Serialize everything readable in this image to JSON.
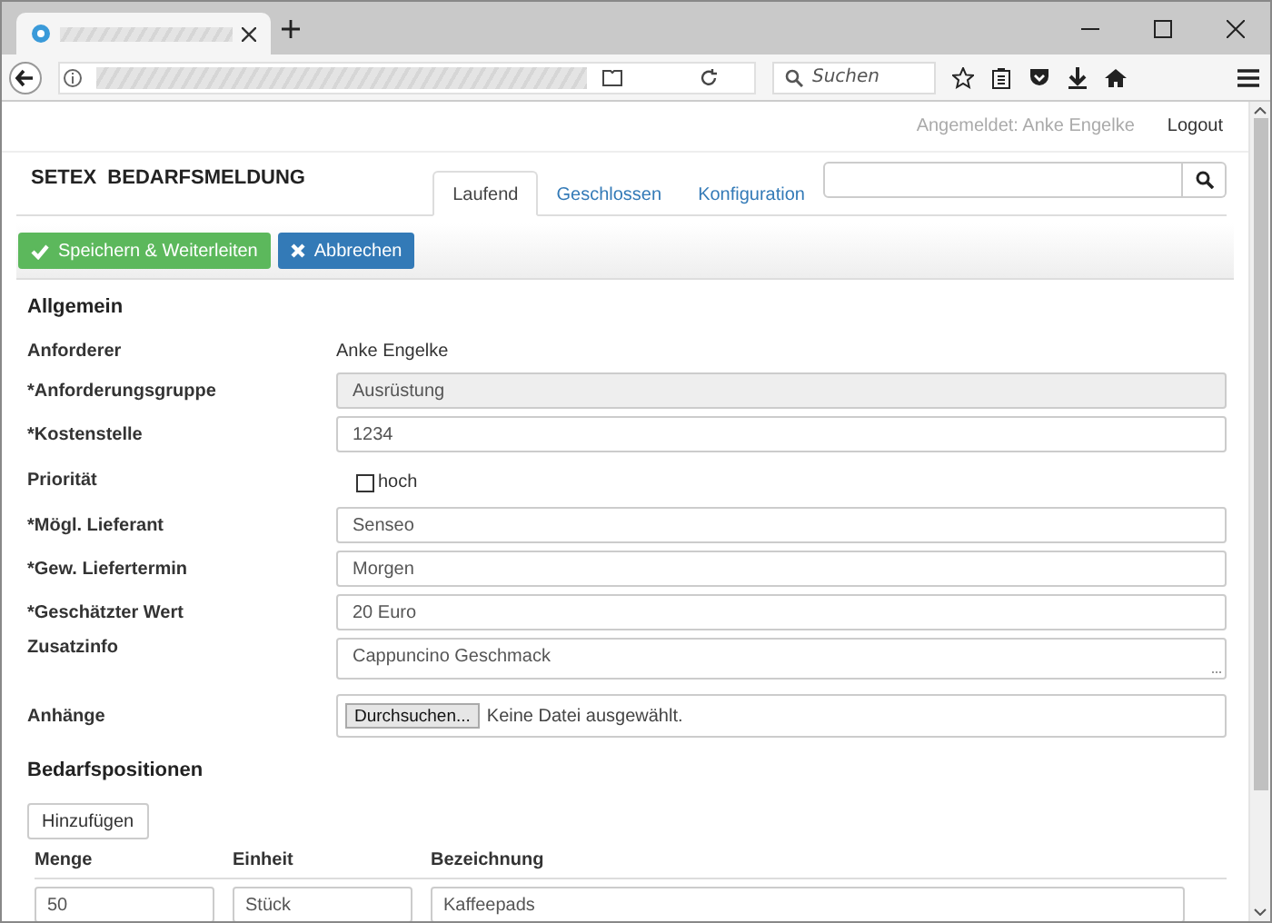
{
  "browser": {
    "search_placeholder": "Suchen"
  },
  "header": {
    "user": "Angemeldet: Anke Engelke",
    "logout": "Logout",
    "title": "SETEX  BEDARFSMELDUNG"
  },
  "tabs": [
    {
      "label": "Laufend",
      "selected": true
    },
    {
      "label": "Geschlossen",
      "selected": false
    },
    {
      "label": "Konfiguration",
      "selected": false
    }
  ],
  "toolbar": [
    {
      "label": "Speichern & Weiterleiten",
      "kind": "save"
    },
    {
      "label": "Abbrechen",
      "kind": "cancel"
    }
  ],
  "general": {
    "heading": "Allgemein",
    "fields": [
      {
        "label": "Anforderer",
        "kind": "static",
        "value": "Anke Engelke"
      },
      {
        "label": "*Anforderungsgruppe",
        "kind": "readonly",
        "value": "Ausrüstung"
      },
      {
        "label": "*Kostenstelle",
        "kind": "text",
        "value": "1234"
      },
      {
        "label": "Priorität",
        "kind": "checkbox",
        "value": "hoch",
        "checked": false
      },
      {
        "label": "*Mögl. Lieferant",
        "kind": "text",
        "value": "Senseo"
      },
      {
        "label": "*Gew. Liefertermin",
        "kind": "text",
        "value": "Morgen"
      },
      {
        "label": "*Geschätzter Wert",
        "kind": "text",
        "value": "20 Euro"
      },
      {
        "label": "Zusatzinfo",
        "kind": "textarea",
        "value": "Cappuncino Geschmack"
      },
      {
        "label": "Anhänge",
        "kind": "file",
        "button": "Durchsuchen...",
        "value": "Keine Datei ausgewählt."
      }
    ]
  },
  "positions": {
    "heading": "Bedarfspositionen",
    "add_button": "Hinzufügen",
    "columns": [
      "Menge",
      "Einheit",
      "Bezeichnung"
    ],
    "rows": [
      [
        "50",
        "Stück",
        "Kaffeepads"
      ]
    ]
  }
}
